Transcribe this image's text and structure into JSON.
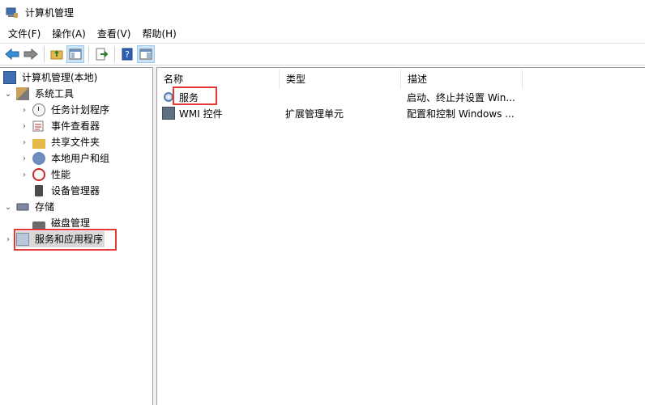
{
  "window": {
    "title": "计算机管理"
  },
  "menu": [
    "文件(F)",
    "操作(A)",
    "查看(V)",
    "帮助(H)"
  ],
  "toolbar": {
    "buttons": [
      {
        "name": "back-icon"
      },
      {
        "name": "forward-icon"
      },
      {
        "name": "up-folder-icon"
      },
      {
        "name": "show-hide-tree-icon"
      },
      {
        "name": "export-list-icon"
      },
      {
        "name": "help-icon"
      },
      {
        "name": "action-pane-icon"
      }
    ]
  },
  "tree": {
    "root": "计算机管理(本地)",
    "system_tools": "系统工具",
    "task_scheduler": "任务计划程序",
    "event_viewer": "事件查看器",
    "shared_folders": "共享文件夹",
    "local_users": "本地用户和组",
    "performance": "性能",
    "device_manager": "设备管理器",
    "storage": "存储",
    "disk_management": "磁盘管理",
    "services_apps": "服务和应用程序"
  },
  "list": {
    "columns": [
      "名称",
      "类型",
      "描述"
    ],
    "rows": [
      {
        "name": "服务",
        "type": "",
        "desc": "启动、终止并设置 Win..."
      },
      {
        "name": "WMI 控件",
        "type": "扩展管理单元",
        "desc": "配置和控制 Windows ..."
      }
    ]
  },
  "colors": {
    "highlight": "#e53935",
    "selection": "#d9d9d9"
  }
}
